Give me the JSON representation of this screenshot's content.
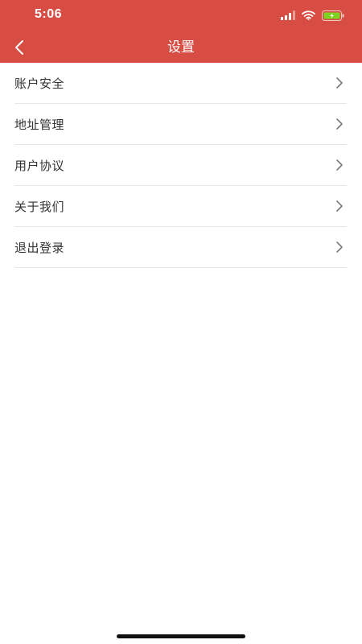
{
  "status_bar": {
    "time": "5:06",
    "signal_icon": "signal-bars-icon",
    "wifi_icon": "wifi-icon",
    "battery_icon": "battery-charging-icon",
    "battery_color": "#7ed321"
  },
  "nav": {
    "title": "设置",
    "back_icon": "chevron-left-icon",
    "background_color": "#d74d44"
  },
  "settings": {
    "items": [
      {
        "label": "账户安全"
      },
      {
        "label": "地址管理"
      },
      {
        "label": "用户协议"
      },
      {
        "label": "关于我们"
      },
      {
        "label": "退出登录"
      }
    ]
  }
}
